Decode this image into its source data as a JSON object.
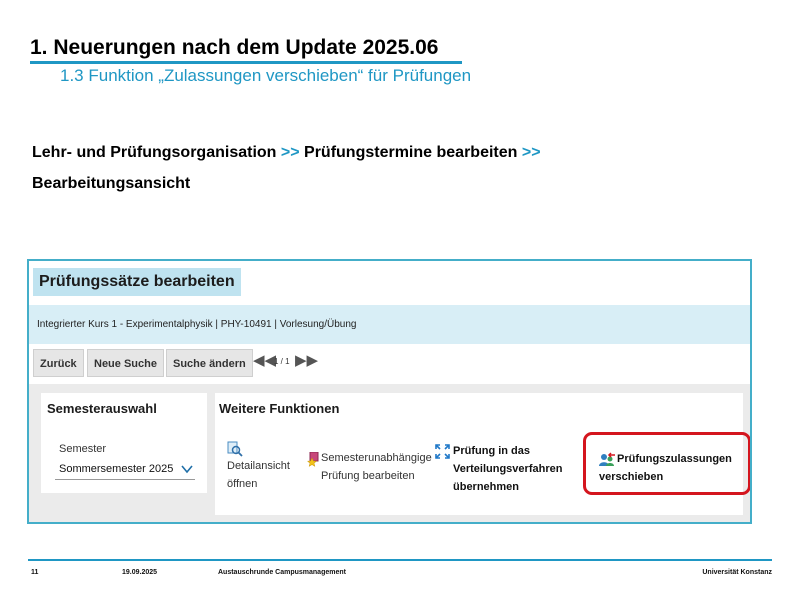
{
  "slide": {
    "title": "1. Neuerungen nach dem Update 2025.06",
    "subtitle": "1.3 Funktion „Zulassungen verschieben“ für Prüfungen",
    "path_line1_a": "Lehr- und Prüfungsorganisation",
    "path_sep": ">>",
    "path_line1_b": "Prüfungstermine bearbeiten",
    "path_line2": "Bearbeitungsansicht"
  },
  "screenshot": {
    "title": "Prüfungssätze bearbeiten",
    "course": "Integrierter Kurs 1 - Experimentalphysik | PHY-10491 | Vorlesung/Übung",
    "buttons": {
      "back": "Zurück",
      "new_search": "Neue Suche",
      "change_search": "Suche ändern"
    },
    "pager": {
      "info": "1 / 1",
      "first_icon": "double-chevron-left-icon",
      "last_icon": "double-chevron-right-icon"
    },
    "semester_panel": {
      "heading": "Semesterauswahl",
      "label": "Semester",
      "value": "Sommersemester 2025"
    },
    "functions_panel": {
      "heading": "Weitere Funktionen",
      "items": [
        {
          "line1": "Detailansicht",
          "line2": "öffnen",
          "icon": "magnifier-document-icon"
        },
        {
          "line1": "Semesterunabhängige",
          "line2": "Prüfung bearbeiten",
          "icon": "star-document-icon"
        },
        {
          "line1": "Prüfung in das",
          "line2": "Verteilungsverfahren",
          "line3": "übernehmen",
          "icon": "expand-arrows-icon"
        },
        {
          "line1": "Prüfungszulassungen",
          "line2": "verschieben",
          "icon": "move-users-icon"
        }
      ]
    },
    "colors": {
      "highlight": "#d4151e",
      "accent": "#1f97c4"
    }
  },
  "footer": {
    "page": "11",
    "date": "19.09.2025",
    "event": "Austauschrunde Campusmanagement",
    "org": "Universität Konstanz"
  }
}
